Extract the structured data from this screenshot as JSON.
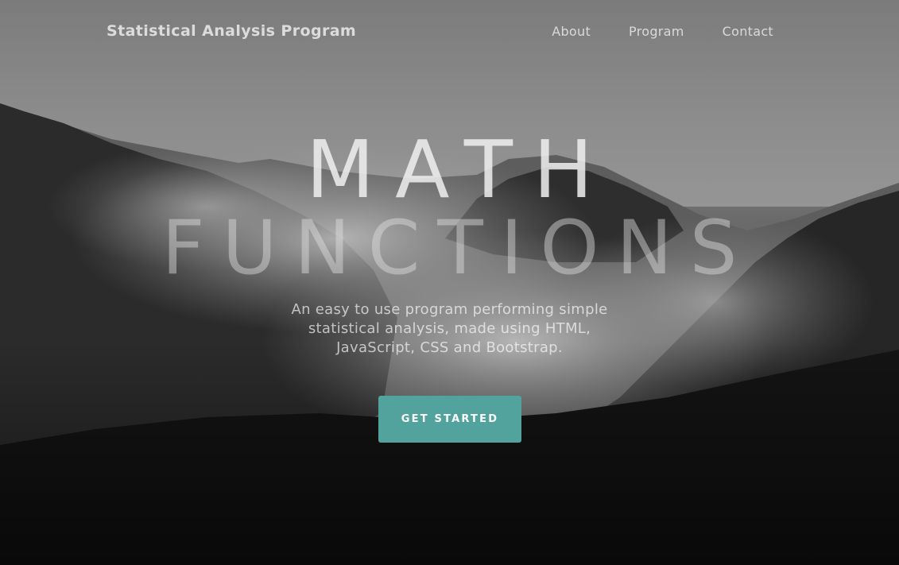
{
  "navbar": {
    "brand": "Statistical Analysis Program",
    "links": [
      {
        "label": "About"
      },
      {
        "label": "Program"
      },
      {
        "label": "Contact"
      }
    ]
  },
  "hero": {
    "title_line1": "MATH",
    "title_line2": "FUNCTIONS",
    "subtitle": "An easy to use program performing simple statistical analysis, made using HTML, JavaScript, CSS and Bootstrap.",
    "cta_label": "GET STARTED"
  },
  "colors": {
    "accent": "#52a39d"
  }
}
